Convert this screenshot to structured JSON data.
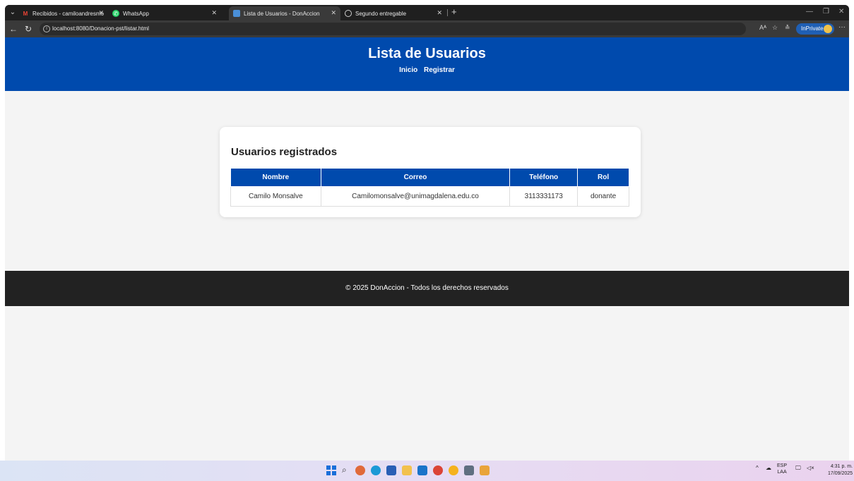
{
  "browser": {
    "tabs": [
      {
        "title": "Recibidos - camiloandresmonsalv",
        "favicon": "gmail-icon",
        "active": false
      },
      {
        "title": "WhatsApp",
        "favicon": "whatsapp-icon",
        "active": false
      },
      {
        "title": "Lista de Usuarios - DonAccion",
        "favicon": "donaccion-icon",
        "active": true
      },
      {
        "title": "Segundo entregable",
        "favicon": "globe-icon",
        "active": false
      }
    ],
    "url": "localhost:8080/Donacion-pst/listar.html",
    "inprivate_label": "InPrivate"
  },
  "page": {
    "header_title": "Lista de Usuarios",
    "nav": [
      "Inicio",
      "Registrar"
    ],
    "card_title": "Usuarios registrados",
    "table": {
      "headers": [
        "Nombre",
        "Correo",
        "Teléfono",
        "Rol"
      ],
      "rows": [
        [
          "Camilo Monsalve",
          "Camilomonsalve@unimagdalena.edu.co",
          "3113331173",
          "donante"
        ]
      ]
    },
    "footer": "© 2025 DonAccion - Todos los derechos reservados"
  },
  "taskbar": {
    "lang": "ESP",
    "lang_sub": "LAA",
    "time": "4:31 p. m.",
    "date": "17/09/2025"
  },
  "colors": {
    "header_blue": "#004aad",
    "footer_dark": "#222222",
    "page_bg": "#f4f4f4"
  }
}
